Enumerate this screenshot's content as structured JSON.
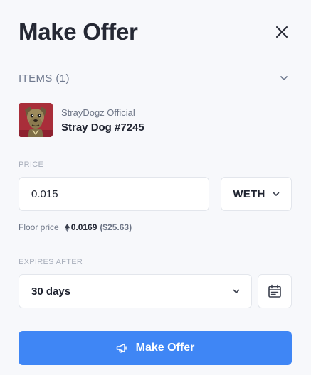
{
  "header": {
    "title": "Make Offer"
  },
  "items": {
    "label": "ITEMS (1)",
    "list": [
      {
        "collection": "StrayDogz Official",
        "name": "Stray Dog #7245"
      }
    ]
  },
  "price": {
    "label": "PRICE",
    "value": "0.015",
    "currency": "WETH",
    "floor_label": "Floor price",
    "floor_value": "0.0169",
    "floor_usd": "($25.63)"
  },
  "expires": {
    "label": "EXPIRES AFTER",
    "selected": "30 days"
  },
  "submit": {
    "label": "Make Offer"
  },
  "colors": {
    "accent": "#3f86f5",
    "background": "#f7f8fb",
    "border": "#e3e6ec",
    "thumb_bg": "#a92e3a"
  },
  "icons": [
    "close-icon",
    "chevron-down-icon",
    "eth-icon",
    "calendar-icon",
    "megaphone-icon"
  ]
}
